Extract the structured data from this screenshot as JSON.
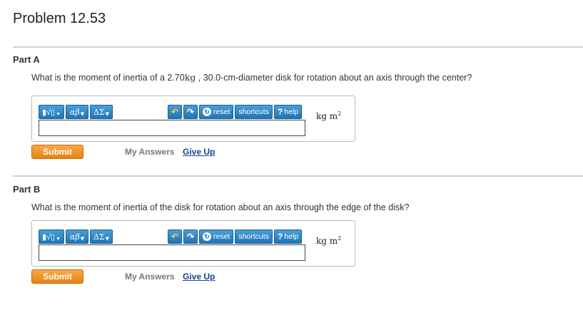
{
  "page": {
    "title": "Problem 12.53"
  },
  "toolbar": {
    "symbols_label": "▮√▯",
    "greek_label": "αβ",
    "delta_label": "ΔΣ",
    "reset_label": "reset",
    "shortcuts_label": "shortcuts",
    "help_label": "help"
  },
  "parts": [
    {
      "title": "Part A",
      "question_pre": "What is the moment of inertia of a 2.70",
      "question_unit": "kg",
      "question_post": " , 30.0-cm-diameter disk for rotation about an axis through the center?",
      "unit": "kg m",
      "unit_exp": "2",
      "input_value": "",
      "submit_label": "Submit",
      "my_answers_label": "My Answers",
      "give_up_label": "Give Up"
    },
    {
      "title": "Part B",
      "question": "What is the moment of inertia of the disk for rotation about an axis through the edge of the disk?",
      "unit": "kg m",
      "unit_exp": "2",
      "input_value": "",
      "submit_label": "Submit",
      "my_answers_label": "My Answers",
      "give_up_label": "Give Up"
    }
  ]
}
